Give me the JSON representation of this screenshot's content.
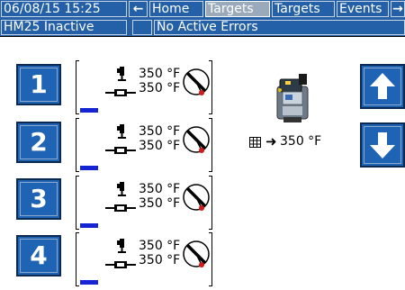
{
  "topbar": {
    "datetime": "06/08/15 15:25",
    "back_arrow": "←",
    "tabs": [
      "Home",
      "Targets",
      "Targets",
      "Events"
    ],
    "forward_arrow": "→"
  },
  "status": {
    "system": "HM25 Inactive",
    "indicator": "",
    "errors": "No Active Errors"
  },
  "zones": [
    {
      "number": "1",
      "actual": "350 °F",
      "setpoint": "350 °F",
      "level": 0.25
    },
    {
      "number": "2",
      "actual": "350 °F",
      "setpoint": "350 °F",
      "level": 0.25
    },
    {
      "number": "3",
      "actual": "350 °F",
      "setpoint": "350 °F",
      "level": 0.25
    },
    {
      "number": "4",
      "actual": "350 °F",
      "setpoint": "350 °F",
      "level": 0.25
    }
  ],
  "machine": {
    "setpoint": "350 °F"
  },
  "colors": {
    "bar_bg": "#2360a8",
    "button": "#1f63b4",
    "level_bar": "#1524d4",
    "gauge_needle": "#d11b1b"
  },
  "icons": [
    "hose-icon",
    "pipe-icon",
    "temperature-gauge-icon",
    "melter-icon",
    "grid-icon",
    "up-arrow-icon",
    "down-arrow-icon"
  ]
}
